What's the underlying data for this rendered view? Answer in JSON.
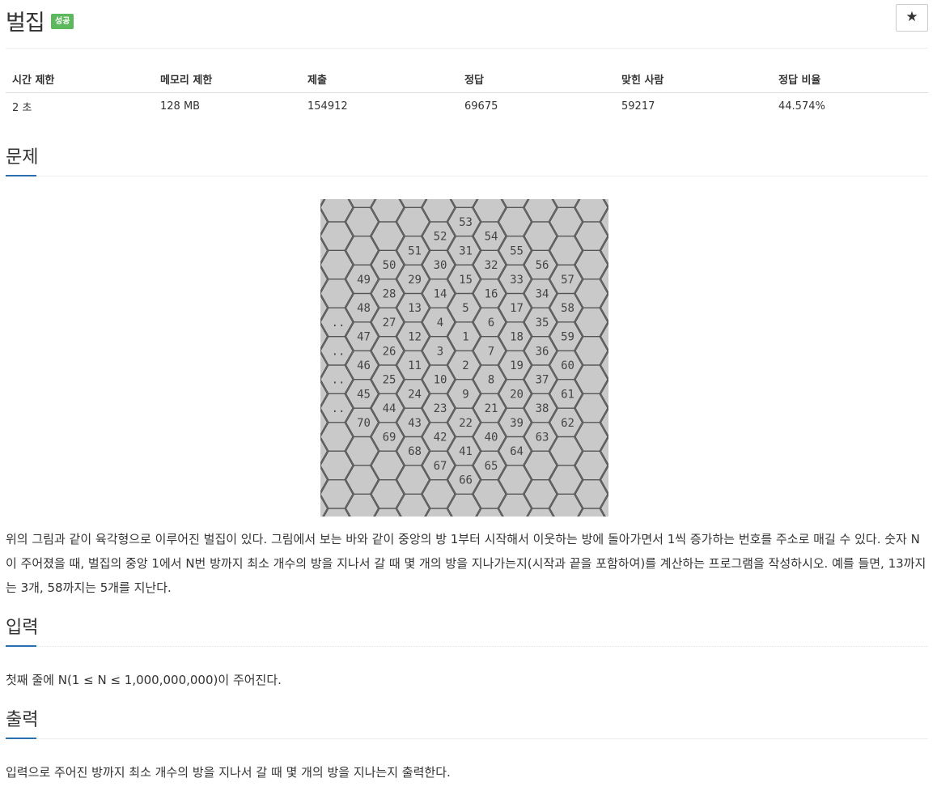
{
  "header": {
    "title": "벌집",
    "badge": "성공",
    "star_label": "★"
  },
  "info_table": {
    "headers": [
      "시간 제한",
      "메모리 제한",
      "제출",
      "정답",
      "맞힌 사람",
      "정답 비율"
    ],
    "row": [
      "2 초",
      "128 MB",
      "154912",
      "69675",
      "59217",
      "44.574%"
    ]
  },
  "sections": {
    "problem": {
      "title": "문제",
      "text": "위의 그림과 같이 육각형으로 이루어진 벌집이 있다. 그림에서 보는 바와 같이 중앙의 방 1부터 시작해서 이웃하는 방에 돌아가면서 1씩 증가하는 번호를 주소로 매길 수 있다. 숫자 N이 주어졌을 때, 벌집의 중앙 1에서 N번 방까지 최소 개수의 방을 지나서 갈 때 몇 개의 방을 지나가는지(시작과 끝을 포함하여)를 계산하는 프로그램을 작성하시오. 예를 들면, 13까지는 3개, 58까지는 5개를 지난다."
    },
    "input": {
      "title": "입력",
      "text": "첫째 줄에 N(1 ≤ N ≤ 1,000,000,000)이 주어진다."
    },
    "output": {
      "title": "출력",
      "text": "입력으로 주어진 방까지 최소 개수의 방을 지나서 갈 때 몇 개의 방을 지나는지 출력한다."
    }
  },
  "figure": {
    "cells": [
      {
        "label": "53",
        "col": 5,
        "row": 0
      },
      {
        "label": "52",
        "col": 4,
        "row": 1
      },
      {
        "label": "54",
        "col": 6,
        "row": 1
      },
      {
        "label": "51",
        "col": 3,
        "row": 2
      },
      {
        "label": "31",
        "col": 5,
        "row": 2
      },
      {
        "label": "55",
        "col": 7,
        "row": 2
      },
      {
        "label": "50",
        "col": 2,
        "row": 3
      },
      {
        "label": "30",
        "col": 4,
        "row": 3
      },
      {
        "label": "32",
        "col": 6,
        "row": 3
      },
      {
        "label": "56",
        "col": 8,
        "row": 3
      },
      {
        "label": "49",
        "col": 1,
        "row": 4
      },
      {
        "label": "29",
        "col": 3,
        "row": 4
      },
      {
        "label": "15",
        "col": 5,
        "row": 4
      },
      {
        "label": "33",
        "col": 7,
        "row": 4
      },
      {
        "label": "57",
        "col": 9,
        "row": 4
      },
      {
        "label": "28",
        "col": 2,
        "row": 5
      },
      {
        "label": "14",
        "col": 4,
        "row": 5
      },
      {
        "label": "16",
        "col": 6,
        "row": 5
      },
      {
        "label": "34",
        "col": 8,
        "row": 5
      },
      {
        "label": "48",
        "col": 1,
        "row": 6
      },
      {
        "label": "13",
        "col": 3,
        "row": 6
      },
      {
        "label": "5",
        "col": 5,
        "row": 6
      },
      {
        "label": "17",
        "col": 7,
        "row": 6
      },
      {
        "label": "58",
        "col": 9,
        "row": 6
      },
      {
        "label": "..",
        "col": 0,
        "row": 7
      },
      {
        "label": "27",
        "col": 2,
        "row": 7
      },
      {
        "label": "4",
        "col": 4,
        "row": 7
      },
      {
        "label": "6",
        "col": 6,
        "row": 7
      },
      {
        "label": "35",
        "col": 8,
        "row": 7
      },
      {
        "label": "47",
        "col": 1,
        "row": 8
      },
      {
        "label": "12",
        "col": 3,
        "row": 8
      },
      {
        "label": "1",
        "col": 5,
        "row": 8
      },
      {
        "label": "18",
        "col": 7,
        "row": 8
      },
      {
        "label": "59",
        "col": 9,
        "row": 8
      },
      {
        "label": "..",
        "col": 0,
        "row": 9
      },
      {
        "label": "26",
        "col": 2,
        "row": 9
      },
      {
        "label": "3",
        "col": 4,
        "row": 9
      },
      {
        "label": "7",
        "col": 6,
        "row": 9
      },
      {
        "label": "36",
        "col": 8,
        "row": 9
      },
      {
        "label": "46",
        "col": 1,
        "row": 10
      },
      {
        "label": "11",
        "col": 3,
        "row": 10
      },
      {
        "label": "2",
        "col": 5,
        "row": 10
      },
      {
        "label": "19",
        "col": 7,
        "row": 10
      },
      {
        "label": "60",
        "col": 9,
        "row": 10
      },
      {
        "label": "..",
        "col": 0,
        "row": 11
      },
      {
        "label": "25",
        "col": 2,
        "row": 11
      },
      {
        "label": "10",
        "col": 4,
        "row": 11
      },
      {
        "label": "8",
        "col": 6,
        "row": 11
      },
      {
        "label": "37",
        "col": 8,
        "row": 11
      },
      {
        "label": "45",
        "col": 1,
        "row": 12
      },
      {
        "label": "24",
        "col": 3,
        "row": 12
      },
      {
        "label": "9",
        "col": 5,
        "row": 12
      },
      {
        "label": "20",
        "col": 7,
        "row": 12
      },
      {
        "label": "61",
        "col": 9,
        "row": 12
      },
      {
        "label": "..",
        "col": 0,
        "row": 13
      },
      {
        "label": "44",
        "col": 2,
        "row": 13
      },
      {
        "label": "23",
        "col": 4,
        "row": 13
      },
      {
        "label": "21",
        "col": 6,
        "row": 13
      },
      {
        "label": "38",
        "col": 8,
        "row": 13
      },
      {
        "label": "70",
        "col": 1,
        "row": 14
      },
      {
        "label": "43",
        "col": 3,
        "row": 14
      },
      {
        "label": "22",
        "col": 5,
        "row": 14
      },
      {
        "label": "39",
        "col": 7,
        "row": 14
      },
      {
        "label": "62",
        "col": 9,
        "row": 14
      },
      {
        "label": "69",
        "col": 2,
        "row": 15
      },
      {
        "label": "42",
        "col": 4,
        "row": 15
      },
      {
        "label": "40",
        "col": 6,
        "row": 15
      },
      {
        "label": "63",
        "col": 8,
        "row": 15
      },
      {
        "label": "68",
        "col": 3,
        "row": 16
      },
      {
        "label": "41",
        "col": 5,
        "row": 16
      },
      {
        "label": "64",
        "col": 7,
        "row": 16
      },
      {
        "label": "67",
        "col": 4,
        "row": 17
      },
      {
        "label": "65",
        "col": 6,
        "row": 17
      },
      {
        "label": "66",
        "col": 5,
        "row": 18
      }
    ]
  }
}
